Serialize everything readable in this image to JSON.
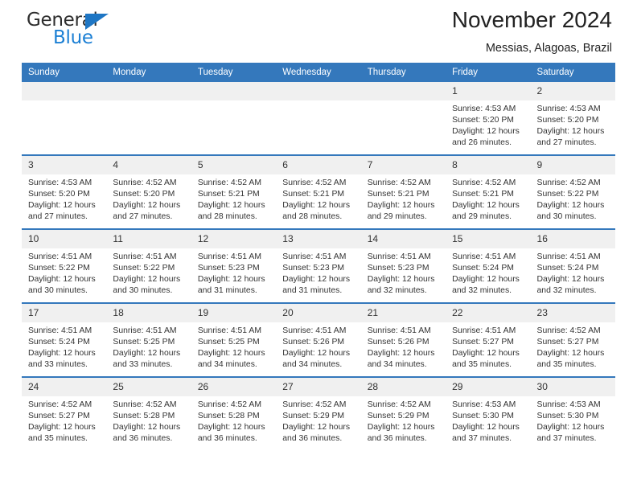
{
  "brand": {
    "name_part1": "General",
    "name_part2": "Blue",
    "accent_color": "#1b7fd4",
    "header_color": "#3478bc"
  },
  "header": {
    "title": "November 2024",
    "subtitle": "Messias, Alagoas, Brazil"
  },
  "weekday_headers": [
    "Sunday",
    "Monday",
    "Tuesday",
    "Wednesday",
    "Thursday",
    "Friday",
    "Saturday"
  ],
  "weeks": [
    [
      {
        "day": "",
        "sunrise": "",
        "sunset": "",
        "daylight_line1": "",
        "daylight_line2": ""
      },
      {
        "day": "",
        "sunrise": "",
        "sunset": "",
        "daylight_line1": "",
        "daylight_line2": ""
      },
      {
        "day": "",
        "sunrise": "",
        "sunset": "",
        "daylight_line1": "",
        "daylight_line2": ""
      },
      {
        "day": "",
        "sunrise": "",
        "sunset": "",
        "daylight_line1": "",
        "daylight_line2": ""
      },
      {
        "day": "",
        "sunrise": "",
        "sunset": "",
        "daylight_line1": "",
        "daylight_line2": ""
      },
      {
        "day": "1",
        "sunrise": "Sunrise: 4:53 AM",
        "sunset": "Sunset: 5:20 PM",
        "daylight_line1": "Daylight: 12 hours",
        "daylight_line2": "and 26 minutes."
      },
      {
        "day": "2",
        "sunrise": "Sunrise: 4:53 AM",
        "sunset": "Sunset: 5:20 PM",
        "daylight_line1": "Daylight: 12 hours",
        "daylight_line2": "and 27 minutes."
      }
    ],
    [
      {
        "day": "3",
        "sunrise": "Sunrise: 4:53 AM",
        "sunset": "Sunset: 5:20 PM",
        "daylight_line1": "Daylight: 12 hours",
        "daylight_line2": "and 27 minutes."
      },
      {
        "day": "4",
        "sunrise": "Sunrise: 4:52 AM",
        "sunset": "Sunset: 5:20 PM",
        "daylight_line1": "Daylight: 12 hours",
        "daylight_line2": "and 27 minutes."
      },
      {
        "day": "5",
        "sunrise": "Sunrise: 4:52 AM",
        "sunset": "Sunset: 5:21 PM",
        "daylight_line1": "Daylight: 12 hours",
        "daylight_line2": "and 28 minutes."
      },
      {
        "day": "6",
        "sunrise": "Sunrise: 4:52 AM",
        "sunset": "Sunset: 5:21 PM",
        "daylight_line1": "Daylight: 12 hours",
        "daylight_line2": "and 28 minutes."
      },
      {
        "day": "7",
        "sunrise": "Sunrise: 4:52 AM",
        "sunset": "Sunset: 5:21 PM",
        "daylight_line1": "Daylight: 12 hours",
        "daylight_line2": "and 29 minutes."
      },
      {
        "day": "8",
        "sunrise": "Sunrise: 4:52 AM",
        "sunset": "Sunset: 5:21 PM",
        "daylight_line1": "Daylight: 12 hours",
        "daylight_line2": "and 29 minutes."
      },
      {
        "day": "9",
        "sunrise": "Sunrise: 4:52 AM",
        "sunset": "Sunset: 5:22 PM",
        "daylight_line1": "Daylight: 12 hours",
        "daylight_line2": "and 30 minutes."
      }
    ],
    [
      {
        "day": "10",
        "sunrise": "Sunrise: 4:51 AM",
        "sunset": "Sunset: 5:22 PM",
        "daylight_line1": "Daylight: 12 hours",
        "daylight_line2": "and 30 minutes."
      },
      {
        "day": "11",
        "sunrise": "Sunrise: 4:51 AM",
        "sunset": "Sunset: 5:22 PM",
        "daylight_line1": "Daylight: 12 hours",
        "daylight_line2": "and 30 minutes."
      },
      {
        "day": "12",
        "sunrise": "Sunrise: 4:51 AM",
        "sunset": "Sunset: 5:23 PM",
        "daylight_line1": "Daylight: 12 hours",
        "daylight_line2": "and 31 minutes."
      },
      {
        "day": "13",
        "sunrise": "Sunrise: 4:51 AM",
        "sunset": "Sunset: 5:23 PM",
        "daylight_line1": "Daylight: 12 hours",
        "daylight_line2": "and 31 minutes."
      },
      {
        "day": "14",
        "sunrise": "Sunrise: 4:51 AM",
        "sunset": "Sunset: 5:23 PM",
        "daylight_line1": "Daylight: 12 hours",
        "daylight_line2": "and 32 minutes."
      },
      {
        "day": "15",
        "sunrise": "Sunrise: 4:51 AM",
        "sunset": "Sunset: 5:24 PM",
        "daylight_line1": "Daylight: 12 hours",
        "daylight_line2": "and 32 minutes."
      },
      {
        "day": "16",
        "sunrise": "Sunrise: 4:51 AM",
        "sunset": "Sunset: 5:24 PM",
        "daylight_line1": "Daylight: 12 hours",
        "daylight_line2": "and 32 minutes."
      }
    ],
    [
      {
        "day": "17",
        "sunrise": "Sunrise: 4:51 AM",
        "sunset": "Sunset: 5:24 PM",
        "daylight_line1": "Daylight: 12 hours",
        "daylight_line2": "and 33 minutes."
      },
      {
        "day": "18",
        "sunrise": "Sunrise: 4:51 AM",
        "sunset": "Sunset: 5:25 PM",
        "daylight_line1": "Daylight: 12 hours",
        "daylight_line2": "and 33 minutes."
      },
      {
        "day": "19",
        "sunrise": "Sunrise: 4:51 AM",
        "sunset": "Sunset: 5:25 PM",
        "daylight_line1": "Daylight: 12 hours",
        "daylight_line2": "and 34 minutes."
      },
      {
        "day": "20",
        "sunrise": "Sunrise: 4:51 AM",
        "sunset": "Sunset: 5:26 PM",
        "daylight_line1": "Daylight: 12 hours",
        "daylight_line2": "and 34 minutes."
      },
      {
        "day": "21",
        "sunrise": "Sunrise: 4:51 AM",
        "sunset": "Sunset: 5:26 PM",
        "daylight_line1": "Daylight: 12 hours",
        "daylight_line2": "and 34 minutes."
      },
      {
        "day": "22",
        "sunrise": "Sunrise: 4:51 AM",
        "sunset": "Sunset: 5:27 PM",
        "daylight_line1": "Daylight: 12 hours",
        "daylight_line2": "and 35 minutes."
      },
      {
        "day": "23",
        "sunrise": "Sunrise: 4:52 AM",
        "sunset": "Sunset: 5:27 PM",
        "daylight_line1": "Daylight: 12 hours",
        "daylight_line2": "and 35 minutes."
      }
    ],
    [
      {
        "day": "24",
        "sunrise": "Sunrise: 4:52 AM",
        "sunset": "Sunset: 5:27 PM",
        "daylight_line1": "Daylight: 12 hours",
        "daylight_line2": "and 35 minutes."
      },
      {
        "day": "25",
        "sunrise": "Sunrise: 4:52 AM",
        "sunset": "Sunset: 5:28 PM",
        "daylight_line1": "Daylight: 12 hours",
        "daylight_line2": "and 36 minutes."
      },
      {
        "day": "26",
        "sunrise": "Sunrise: 4:52 AM",
        "sunset": "Sunset: 5:28 PM",
        "daylight_line1": "Daylight: 12 hours",
        "daylight_line2": "and 36 minutes."
      },
      {
        "day": "27",
        "sunrise": "Sunrise: 4:52 AM",
        "sunset": "Sunset: 5:29 PM",
        "daylight_line1": "Daylight: 12 hours",
        "daylight_line2": "and 36 minutes."
      },
      {
        "day": "28",
        "sunrise": "Sunrise: 4:52 AM",
        "sunset": "Sunset: 5:29 PM",
        "daylight_line1": "Daylight: 12 hours",
        "daylight_line2": "and 36 minutes."
      },
      {
        "day": "29",
        "sunrise": "Sunrise: 4:53 AM",
        "sunset": "Sunset: 5:30 PM",
        "daylight_line1": "Daylight: 12 hours",
        "daylight_line2": "and 37 minutes."
      },
      {
        "day": "30",
        "sunrise": "Sunrise: 4:53 AM",
        "sunset": "Sunset: 5:30 PM",
        "daylight_line1": "Daylight: 12 hours",
        "daylight_line2": "and 37 minutes."
      }
    ]
  ]
}
